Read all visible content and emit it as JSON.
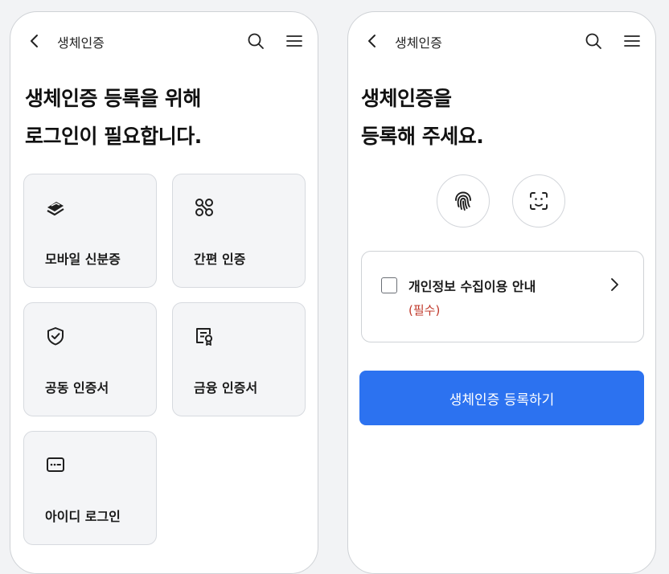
{
  "left_screen": {
    "header": {
      "title": "생체인증"
    },
    "heading": {
      "line1": "생체인증 등록을 위해",
      "line2": "로그인이 필요합니다."
    },
    "options": [
      {
        "label": "모바일 신분증",
        "icon": "mobile-id-icon"
      },
      {
        "label": "간편 인증",
        "icon": "simple-auth-icon"
      },
      {
        "label": "공동 인증서",
        "icon": "shield-check-icon"
      },
      {
        "label": "금융 인증서",
        "icon": "certificate-icon"
      },
      {
        "label": "아이디 로그인",
        "icon": "id-login-icon"
      }
    ]
  },
  "right_screen": {
    "header": {
      "title": "생체인증"
    },
    "heading": {
      "line1": "생체인증을",
      "line2": "등록해 주세요."
    },
    "biometrics": [
      {
        "icon": "fingerprint-icon"
      },
      {
        "icon": "face-id-icon"
      }
    ],
    "consent": {
      "label": "개인정보 수집이용 안내",
      "required": "(필수)",
      "checked": false
    },
    "register_button": "생체인증 등록하기"
  },
  "colors": {
    "primary": "#2c72f0",
    "required": "#c0392b",
    "card_bg": "#f4f5f7"
  }
}
